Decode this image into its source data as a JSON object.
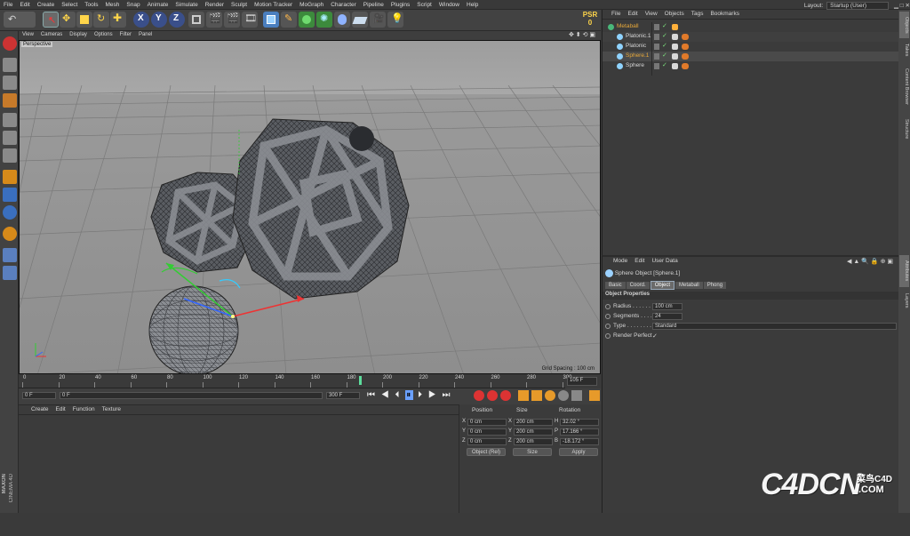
{
  "menubar": [
    "File",
    "Edit",
    "Create",
    "Select",
    "Tools",
    "Mesh",
    "Snap",
    "Animate",
    "Simulate",
    "Render",
    "Sculpt",
    "Motion Tracker",
    "MoGraph",
    "Character",
    "Pipeline",
    "Plugins",
    "Script",
    "Window",
    "Help"
  ],
  "layout": {
    "label": "Layout:",
    "value": "Startup (User)"
  },
  "psr": {
    "label": "PSR",
    "value": "0"
  },
  "viewport": {
    "menu": [
      "View",
      "Cameras",
      "Display",
      "Options",
      "Filter",
      "Panel"
    ],
    "label": "Perspective",
    "grid_spacing": "Grid Spacing : 100 cm"
  },
  "timeline": {
    "ticks": [
      "0",
      "20",
      "40",
      "60",
      "80",
      "100",
      "120",
      "140",
      "160",
      "180",
      "200",
      "220",
      "240",
      "260",
      "280",
      "300"
    ],
    "end_frame": "105 F",
    "current": 165
  },
  "transport": {
    "start": "0 F",
    "min": "0 F",
    "max_field": "300 F",
    "range_end": "300 F"
  },
  "material": {
    "menu": [
      "Create",
      "Edit",
      "Function",
      "Texture"
    ]
  },
  "coords": {
    "headers": [
      "Position",
      "Size",
      "Rotation"
    ],
    "rows": [
      {
        "axis": "X",
        "pos": "0 cm",
        "saxis": "X",
        "size": "200 cm",
        "raxis": "H",
        "rot": "32.02 °"
      },
      {
        "axis": "Y",
        "pos": "0 cm",
        "saxis": "Y",
        "size": "200 cm",
        "raxis": "P",
        "rot": "17.166 °"
      },
      {
        "axis": "Z",
        "pos": "0 cm",
        "saxis": "Z",
        "size": "200 cm",
        "raxis": "B",
        "rot": "-18.172 °"
      }
    ],
    "mode": "Object (Rel)",
    "size_mode": "Size",
    "apply": "Apply"
  },
  "objects": {
    "menu": [
      "File",
      "Edit",
      "View",
      "Objects",
      "Tags",
      "Bookmarks"
    ],
    "items": [
      {
        "name": "Metaball",
        "indent": 0,
        "selected": false,
        "color": "#e7a83a"
      },
      {
        "name": "Platonic.1",
        "indent": 1,
        "selected": false,
        "color": "#d8d8d8"
      },
      {
        "name": "Platonic",
        "indent": 1,
        "selected": false,
        "color": "#d8d8d8"
      },
      {
        "name": "Sphere.1",
        "indent": 1,
        "selected": true,
        "color": "#e7a83a"
      },
      {
        "name": "Sphere",
        "indent": 1,
        "selected": false,
        "color": "#d8d8d8"
      }
    ]
  },
  "attributes": {
    "menu": [
      "Mode",
      "Edit",
      "User Data"
    ],
    "title": "Sphere Object [Sphere.1]",
    "tabs": [
      "Basic",
      "Coord.",
      "Object",
      "Metaball",
      "Phong"
    ],
    "active_tab": "Object",
    "section": "Object Properties",
    "props": [
      {
        "label": "Radius . . . . . .",
        "value": "100 cm"
      },
      {
        "label": "Segments . . . .",
        "value": "24"
      },
      {
        "label": "Type . . . . . . . .",
        "value": "Standard"
      },
      {
        "label": "Render Perfect",
        "value": "✓"
      }
    ]
  },
  "right_tabs": [
    "Objects",
    "Takes",
    "Content Browser",
    "Structure",
    "Attributes",
    "Layers"
  ],
  "brand": {
    "maxon": "MAXON",
    "cinema": "CINEMA 4D",
    "watermark": "C4DCN",
    "watermark_cn": "菜鸟C4D",
    "watermark_com": ".COM"
  }
}
